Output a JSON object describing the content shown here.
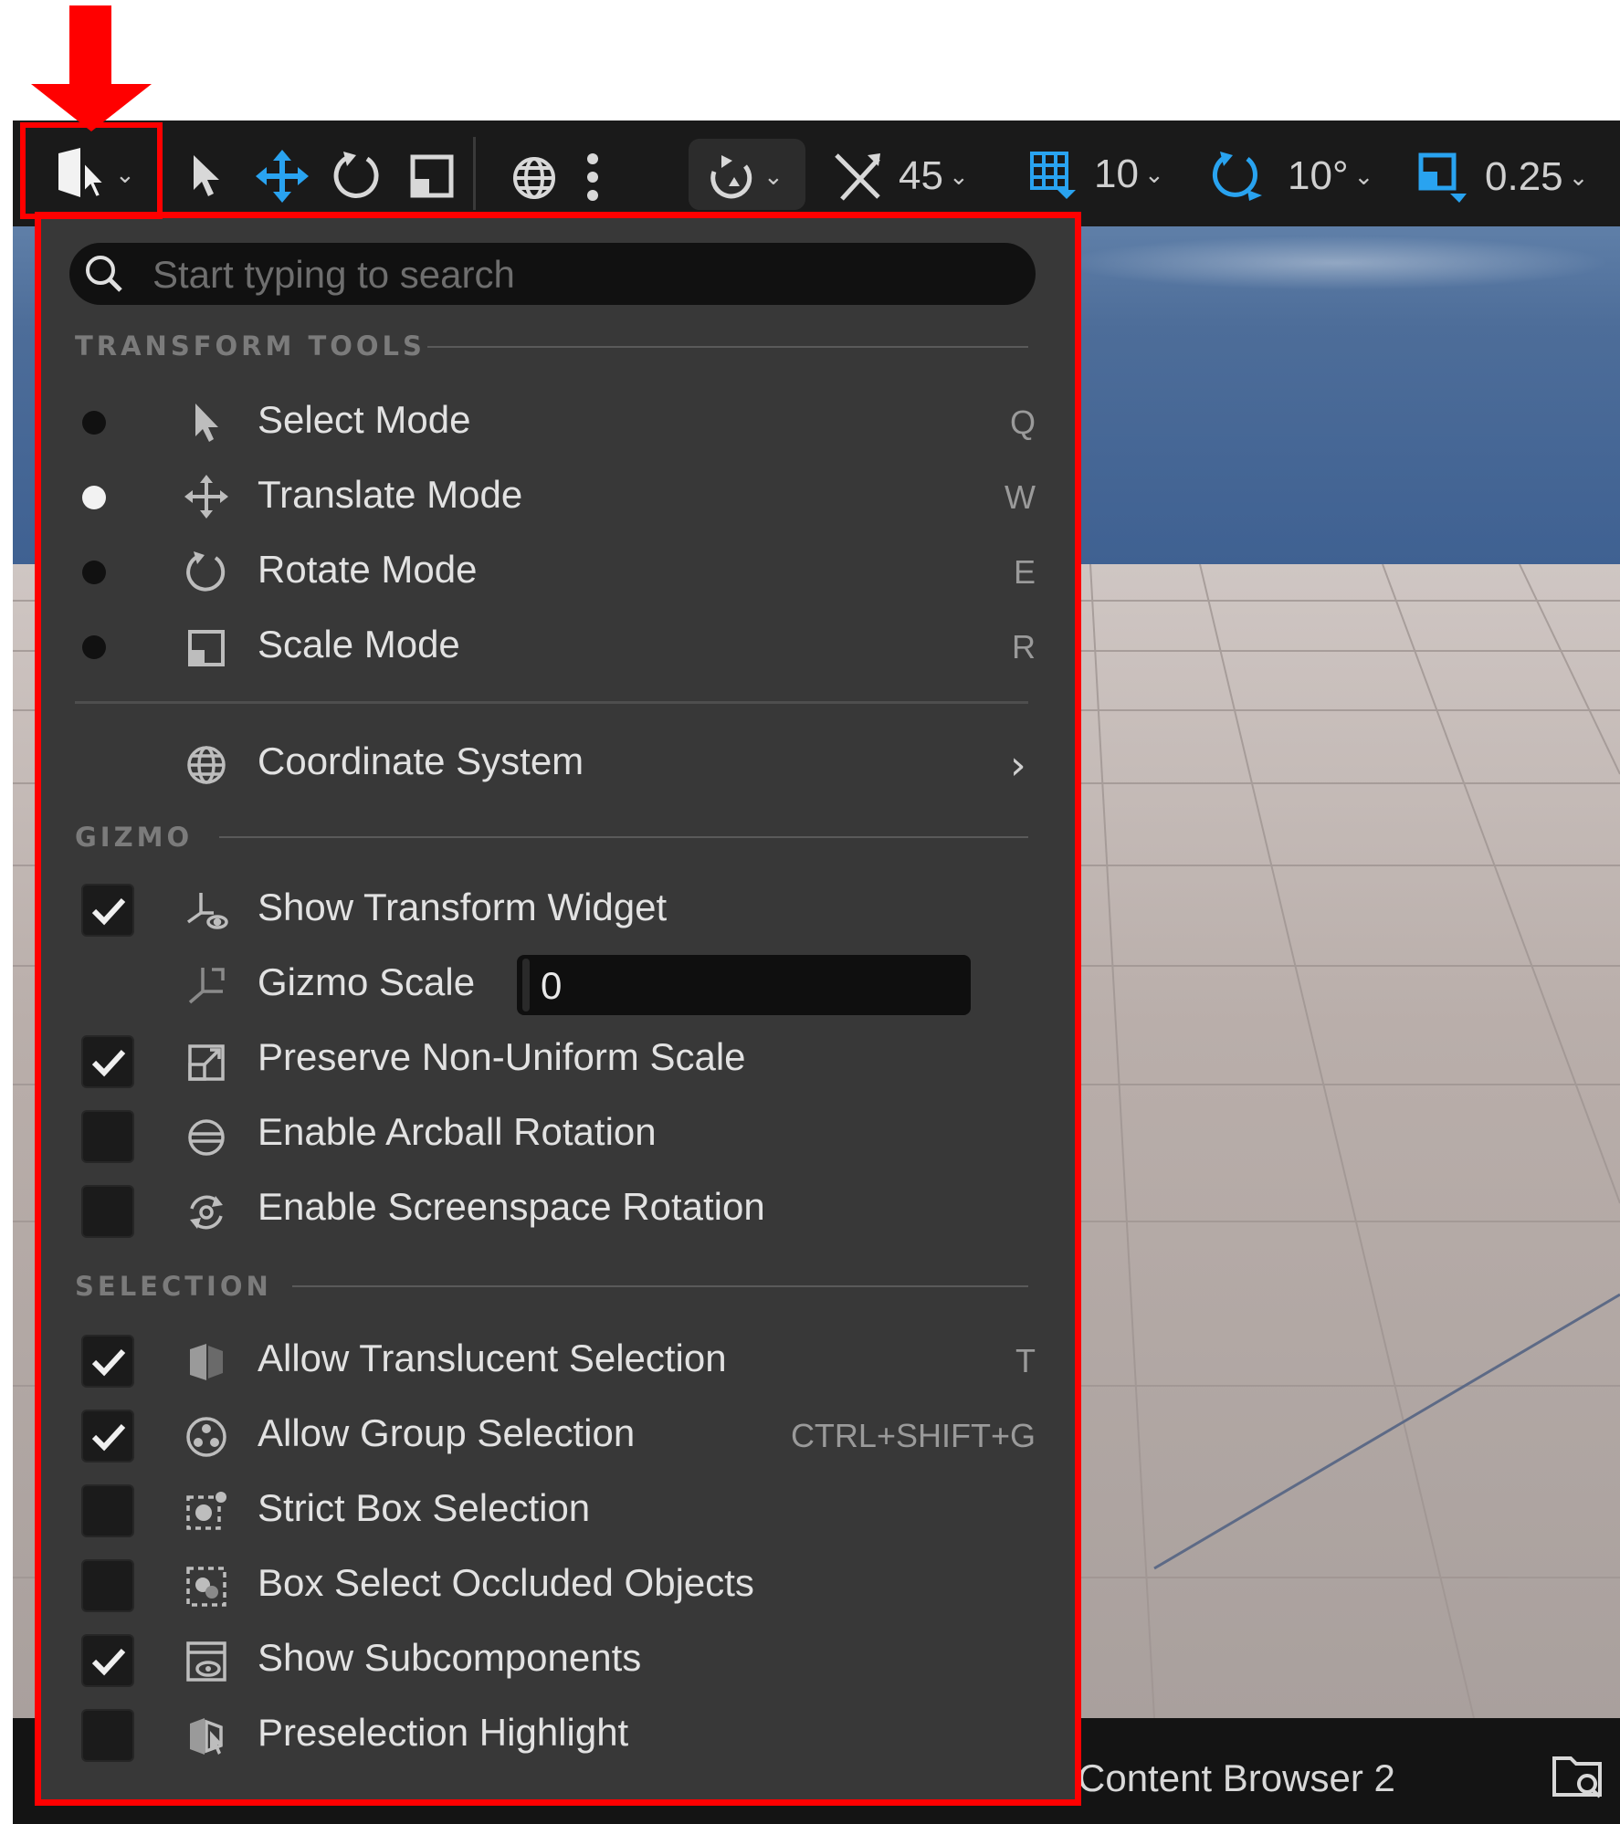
{
  "toolbar": {
    "angle_snap_value": "45",
    "grid_snap_value": "10",
    "rotation_snap_value": "10°",
    "scale_snap_value": "0.25"
  },
  "menu": {
    "search": {
      "placeholder": "Start typing to search",
      "value": ""
    },
    "sections": {
      "transform_tools": "TRANSFORM TOOLS",
      "gizmo": "GIZMO",
      "selection": "SELECTION"
    },
    "transform_tools": [
      {
        "label": "Select Mode",
        "shortcut": "Q",
        "selected": false
      },
      {
        "label": "Translate Mode",
        "shortcut": "W",
        "selected": true
      },
      {
        "label": "Rotate Mode",
        "shortcut": "E",
        "selected": false
      },
      {
        "label": "Scale Mode",
        "shortcut": "R",
        "selected": false
      }
    ],
    "coordinate_system": {
      "label": "Coordinate System",
      "submenu_glyph": "›"
    },
    "gizmo": {
      "show_transform_widget": {
        "label": "Show Transform Widget",
        "checked": true
      },
      "gizmo_scale": {
        "label": "Gizmo Scale",
        "value": "0"
      },
      "preserve_non_uniform_scale": {
        "label": "Preserve Non-Uniform Scale",
        "checked": true
      },
      "enable_arcball_rotation": {
        "label": "Enable Arcball Rotation",
        "checked": false
      },
      "enable_screenspace_rotation": {
        "label": "Enable Screenspace Rotation",
        "checked": false
      }
    },
    "selection": [
      {
        "label": "Allow Translucent Selection",
        "shortcut": "T",
        "checked": true,
        "icon": "translucent-icon"
      },
      {
        "label": "Allow Group Selection",
        "shortcut": "CTRL+SHIFT+G",
        "checked": true,
        "icon": "group-icon"
      },
      {
        "label": "Strict Box Selection",
        "shortcut": "",
        "checked": false,
        "icon": "strict-box-icon"
      },
      {
        "label": "Box Select Occluded Objects",
        "shortcut": "",
        "checked": false,
        "icon": "box-occluded-icon"
      },
      {
        "label": "Show Subcomponents",
        "shortcut": "",
        "checked": true,
        "icon": "subcomponents-icon"
      },
      {
        "label": "Preselection Highlight",
        "shortcut": "",
        "checked": false,
        "icon": "preselection-icon"
      }
    ]
  },
  "bottom_bar": {
    "content_browser_tab": "Content Browser 2"
  },
  "colors": {
    "accent_blue": "#29a3f0",
    "menu_bg": "#383838",
    "annotation_red": "#ff0000"
  }
}
